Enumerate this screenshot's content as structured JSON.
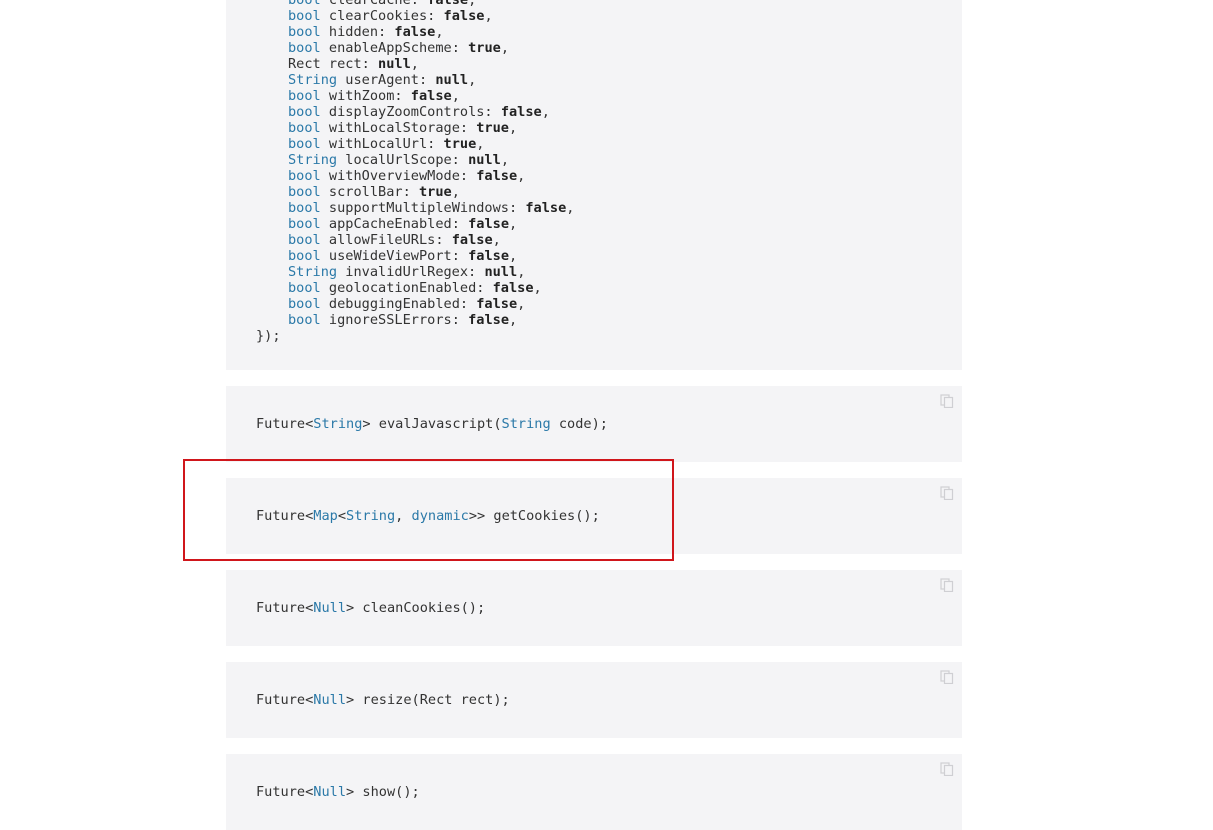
{
  "colors": {
    "type_accent": "#2b79a8",
    "highlight_border": "#d0161b",
    "code_bg": "#f4f4f6"
  },
  "icons": {
    "copy": "copy-icon"
  },
  "config_block": {
    "params": [
      {
        "type": "bool",
        "name": "clearCache",
        "value": "false"
      },
      {
        "type": "bool",
        "name": "clearCookies",
        "value": "false"
      },
      {
        "type": "bool",
        "name": "hidden",
        "value": "false"
      },
      {
        "type": "bool",
        "name": "enableAppScheme",
        "value": "true"
      },
      {
        "type": "Rect",
        "name": "rect",
        "value": "null"
      },
      {
        "type": "String",
        "name": "userAgent",
        "value": "null"
      },
      {
        "type": "bool",
        "name": "withZoom",
        "value": "false"
      },
      {
        "type": "bool",
        "name": "displayZoomControls",
        "value": "false"
      },
      {
        "type": "bool",
        "name": "withLocalStorage",
        "value": "true"
      },
      {
        "type": "bool",
        "name": "withLocalUrl",
        "value": "true"
      },
      {
        "type": "String",
        "name": "localUrlScope",
        "value": "null"
      },
      {
        "type": "bool",
        "name": "withOverviewMode",
        "value": "false"
      },
      {
        "type": "bool",
        "name": "scrollBar",
        "value": "true"
      },
      {
        "type": "bool",
        "name": "supportMultipleWindows",
        "value": "false"
      },
      {
        "type": "bool",
        "name": "appCacheEnabled",
        "value": "false"
      },
      {
        "type": "bool",
        "name": "allowFileURLs",
        "value": "false"
      },
      {
        "type": "bool",
        "name": "useWideViewPort",
        "value": "false"
      },
      {
        "type": "String",
        "name": "invalidUrlRegex",
        "value": "null"
      },
      {
        "type": "bool",
        "name": "geolocationEnabled",
        "value": "false"
      },
      {
        "type": "bool",
        "name": "debuggingEnabled",
        "value": "false"
      },
      {
        "type": "bool",
        "name": "ignoreSSLErrors",
        "value": "false"
      }
    ],
    "closing": "});"
  },
  "snippets": [
    {
      "id": "evalJavascript",
      "tokens": [
        {
          "text": "Future<",
          "cls": ""
        },
        {
          "text": "String",
          "cls": "t"
        },
        {
          "text": "> evalJavascript(",
          "cls": ""
        },
        {
          "text": "String",
          "cls": "t"
        },
        {
          "text": " code);",
          "cls": ""
        }
      ]
    },
    {
      "id": "getCookies",
      "tokens": [
        {
          "text": "Future<",
          "cls": ""
        },
        {
          "text": "Map",
          "cls": "t"
        },
        {
          "text": "<",
          "cls": ""
        },
        {
          "text": "String",
          "cls": "t"
        },
        {
          "text": ", ",
          "cls": ""
        },
        {
          "text": "dynamic",
          "cls": "t"
        },
        {
          "text": ">> getCookies();",
          "cls": ""
        }
      ]
    },
    {
      "id": "cleanCookies",
      "tokens": [
        {
          "text": "Future<",
          "cls": ""
        },
        {
          "text": "Null",
          "cls": "t"
        },
        {
          "text": "> cleanCookies();",
          "cls": ""
        }
      ]
    },
    {
      "id": "resize",
      "tokens": [
        {
          "text": "Future<",
          "cls": ""
        },
        {
          "text": "Null",
          "cls": "t"
        },
        {
          "text": "> resize(Rect rect);",
          "cls": ""
        }
      ]
    },
    {
      "id": "show",
      "tokens": [
        {
          "text": "Future<",
          "cls": ""
        },
        {
          "text": "Null",
          "cls": "t"
        },
        {
          "text": "> show();",
          "cls": ""
        }
      ]
    }
  ]
}
